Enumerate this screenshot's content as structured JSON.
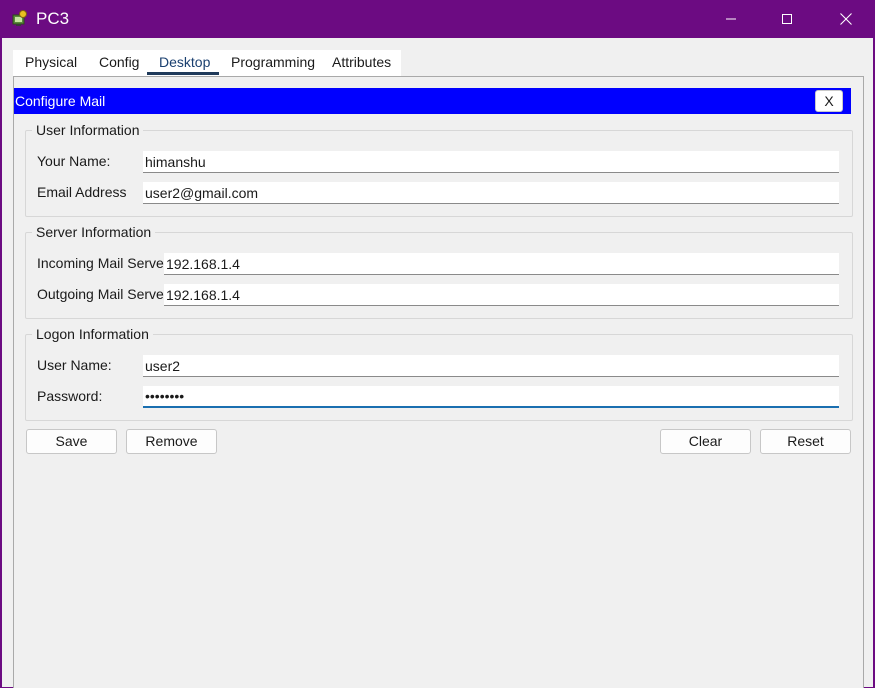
{
  "window": {
    "title": "PC3"
  },
  "tabs": [
    {
      "label": "Physical"
    },
    {
      "label": "Config"
    },
    {
      "label": "Desktop",
      "active": true
    },
    {
      "label": "Programming"
    },
    {
      "label": "Attributes"
    }
  ],
  "mail": {
    "header_title": "Configure Mail",
    "close_label": "X",
    "header_color": "#0000ff",
    "user_info": {
      "legend": "User Information",
      "your_name_label": "Your Name:",
      "your_name_value": "himanshu",
      "email_label": "Email Address",
      "email_value": "user2@gmail.com"
    },
    "server_info": {
      "legend": "Server Information",
      "incoming_label": "Incoming Mail Server",
      "incoming_value": "192.168.1.4",
      "outgoing_label": "Outgoing Mail Server",
      "outgoing_value": "192.168.1.4"
    },
    "logon_info": {
      "legend": "Logon Information",
      "username_label": "User Name:",
      "username_value": "user2",
      "password_label": "Password:",
      "password_value": "password"
    },
    "buttons": {
      "save": "Save",
      "remove": "Remove",
      "clear": "Clear",
      "reset": "Reset"
    }
  },
  "colors": {
    "titlebar": "#6c0b82",
    "accent": "#1a6fb0"
  }
}
